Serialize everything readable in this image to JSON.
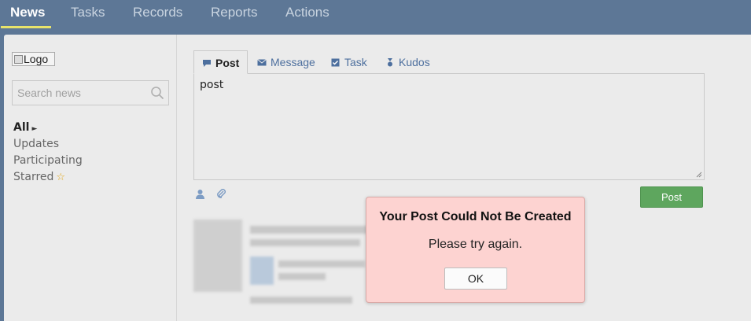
{
  "nav": {
    "tabs": [
      {
        "label": "News",
        "active": true
      },
      {
        "label": "Tasks"
      },
      {
        "label": "Records"
      },
      {
        "label": "Reports"
      },
      {
        "label": "Actions"
      }
    ]
  },
  "sidebar": {
    "logo_alt": "Logo",
    "search_placeholder": "Search news",
    "filters": [
      {
        "label": "All",
        "active": true
      },
      {
        "label": "Updates"
      },
      {
        "label": "Participating"
      },
      {
        "label": "Starred"
      }
    ]
  },
  "composer": {
    "tabs": [
      {
        "label": "Post",
        "icon": "speech-bubble-icon",
        "active": true
      },
      {
        "label": "Message",
        "icon": "envelope-icon"
      },
      {
        "label": "Task",
        "icon": "checkbox-icon"
      },
      {
        "label": "Kudos",
        "icon": "medal-icon"
      }
    ],
    "text": "post",
    "post_label": "Post"
  },
  "dialog": {
    "title": "Your Post Could Not Be Created",
    "message": "Please try again.",
    "ok_label": "OK",
    "bg_color": "#fdd3d1"
  },
  "colors": {
    "nav_bg": "#5d7796",
    "nav_active_underline": "#e8e36a",
    "post_button": "#5ea65e",
    "link": "#4d6f9e"
  }
}
